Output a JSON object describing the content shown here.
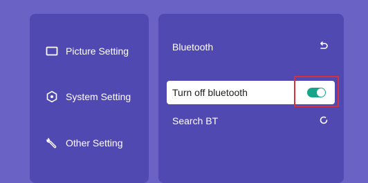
{
  "sidebar": {
    "items": [
      {
        "label": "Picture Setting",
        "icon": "picture-icon"
      },
      {
        "label": "System Setting",
        "icon": "system-icon"
      },
      {
        "label": "Other Setting",
        "icon": "wrench-icon"
      }
    ]
  },
  "bluetooth": {
    "title": "Bluetooth",
    "back_icon": "back-icon",
    "turn_off_label": "Turn off bluetooth",
    "toggle_on": true,
    "search_label": "Search BT",
    "refresh_icon": "refresh-icon"
  },
  "colors": {
    "background": "#6a62c4",
    "panel": "#5149b2",
    "toggle_on": "#17a589",
    "highlight_box": "#d8303a"
  }
}
